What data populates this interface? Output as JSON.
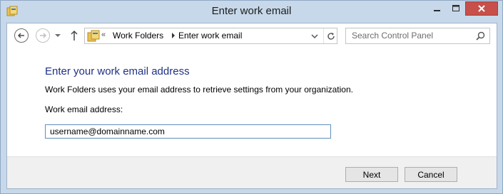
{
  "window": {
    "title": "Enter work email",
    "accent": "#c7d8ea",
    "close_color": "#c7504a"
  },
  "nav": {
    "back_icon": "back-arrow-icon",
    "forward_icon": "forward-arrow-icon",
    "recent_icon": "chevron-down-icon",
    "up_icon": "up-arrow-icon"
  },
  "address": {
    "chevron": "«",
    "crumbs": [
      "Work Folders",
      "Enter work email"
    ]
  },
  "search": {
    "placeholder": "Search Control Panel"
  },
  "main": {
    "heading": "Enter your work email address",
    "description": "Work Folders uses your email address to retrieve settings from your organization.",
    "field_label": "Work email address:",
    "email_value": "username@domainname.com",
    "heading_color": "#1e3287"
  },
  "footer": {
    "next_label": "Next",
    "cancel_label": "Cancel"
  }
}
